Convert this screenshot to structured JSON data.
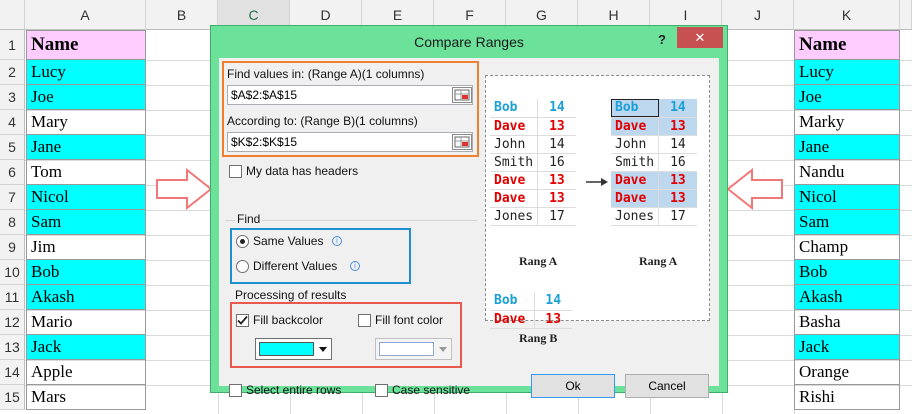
{
  "columns": [
    "A",
    "B",
    "C",
    "D",
    "E",
    "F",
    "G",
    "H",
    "I",
    "J",
    "K"
  ],
  "rows": [
    "1",
    "2",
    "3",
    "4",
    "5",
    "6",
    "7",
    "8",
    "9",
    "10",
    "11",
    "12",
    "13",
    "14",
    "15"
  ],
  "col_a": {
    "header": "Name",
    "values": [
      "Lucy",
      "Joe",
      "Mary",
      "Jane",
      "Tom",
      "Nicol",
      "Sam",
      "Jim",
      "Bob",
      "Akash",
      "Mario",
      "Jack",
      "Apple",
      "Mars"
    ]
  },
  "col_k": {
    "header": "Name",
    "values": [
      "Lucy",
      "Joe",
      "Marky",
      "Jane",
      "Nandu",
      "Nicol",
      "Sam",
      "Champ",
      "Bob",
      "Akash",
      "Basha",
      "Jack",
      "Orange",
      "Rishi"
    ]
  },
  "colors": {
    "highlight": "#00ffff",
    "header_bg": "#ffccff",
    "dialog": "#6be19a",
    "orange_box": "#f08030",
    "blue_box": "#1e90d0",
    "red_box": "#e8584f"
  },
  "dialog": {
    "title": "Compare Ranges",
    "help": "?",
    "close": "✕",
    "find_label": "Find values in: (Range A)(1 columns)",
    "find_value": "$A$2:$A$15",
    "according_label": "According to: (Range B)(1 columns)",
    "according_value": "$K$2:$K$15",
    "headers_label": "My data has headers",
    "find_group": "Find",
    "same_values": "Same Values",
    "different_values": "Different Values",
    "processing_group": "Processing of results",
    "fill_backcolor": "Fill backcolor",
    "fill_font_color": "Fill font color",
    "select_rows": "Select entire rows",
    "case_sensitive": "Case sensitive",
    "ok": "Ok",
    "cancel": "Cancel"
  },
  "preview": {
    "before": [
      [
        "Bob",
        "14"
      ],
      [
        "Dave",
        "13"
      ],
      [
        "John",
        "14"
      ],
      [
        "Smith",
        "16"
      ],
      [
        "Dave",
        "13"
      ],
      [
        "Dave",
        "13"
      ],
      [
        "Jones",
        "17"
      ]
    ],
    "after": [
      [
        "Bob",
        "14"
      ],
      [
        "Dave",
        "13"
      ],
      [
        "John",
        "14"
      ],
      [
        "Smith",
        "16"
      ],
      [
        "Dave",
        "13"
      ],
      [
        "Dave",
        "13"
      ],
      [
        "Jones",
        "17"
      ]
    ],
    "range_b": [
      [
        "Bob",
        "14"
      ],
      [
        "Dave",
        "13"
      ]
    ],
    "caption_before": "Rang A",
    "caption_after": "Rang A",
    "caption_b": "Rang B"
  }
}
